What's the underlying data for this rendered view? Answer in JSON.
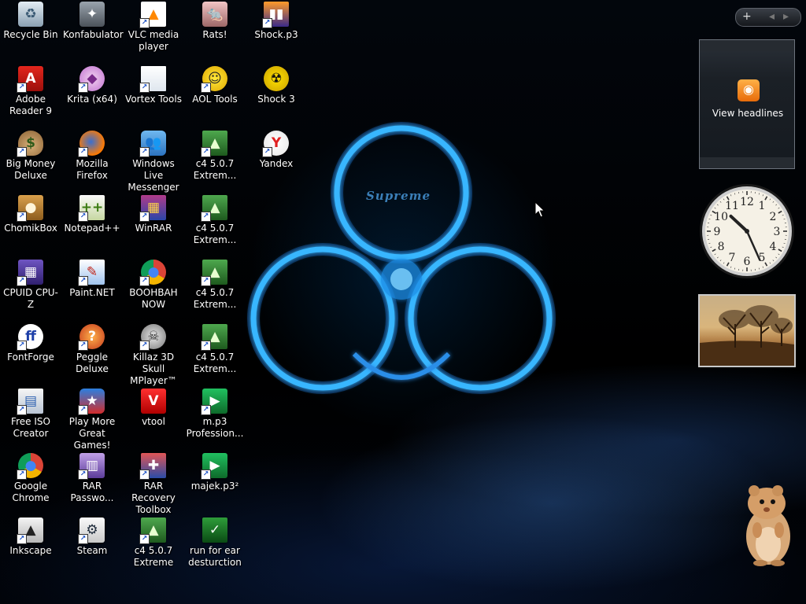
{
  "desktop": {
    "wallpaper_text": "Supreme",
    "icons": [
      {
        "label": "Recycle Bin",
        "icon": "recycle-bin-icon",
        "shortcut": false
      },
      {
        "label": "Adobe Reader 9",
        "icon": "adobe-reader-icon",
        "shortcut": true
      },
      {
        "label": "Big Money Deluxe",
        "icon": "money-bag-icon",
        "shortcut": true
      },
      {
        "label": "ChomikBox",
        "icon": "chomikbox-icon",
        "shortcut": true
      },
      {
        "label": "CPUID CPU-Z",
        "icon": "cpu-z-icon",
        "shortcut": true
      },
      {
        "label": "FontForge",
        "icon": "fontforge-icon",
        "shortcut": true
      },
      {
        "label": "Free ISO Creator",
        "icon": "iso-creator-icon",
        "shortcut": true
      },
      {
        "label": "Google Chrome",
        "icon": "chrome-icon",
        "shortcut": true
      },
      {
        "label": "Inkscape",
        "icon": "inkscape-icon",
        "shortcut": true
      },
      {
        "label": "Konfabulator",
        "icon": "konfabulator-icon",
        "shortcut": false
      },
      {
        "label": "Krita (x64)",
        "icon": "krita-icon",
        "shortcut": true
      },
      {
        "label": "Mozilla Firefox",
        "icon": "firefox-icon",
        "shortcut": true
      },
      {
        "label": "Notepad++",
        "icon": "notepad-plus-plus-icon",
        "shortcut": true
      },
      {
        "label": "Paint.NET",
        "icon": "paint-net-icon",
        "shortcut": true
      },
      {
        "label": "Peggle Deluxe",
        "icon": "peggle-icon",
        "shortcut": true
      },
      {
        "label": "Play More Great Games!",
        "icon": "games-icon",
        "shortcut": true
      },
      {
        "label": "RAR Passwo...",
        "icon": "rar-password-icon",
        "shortcut": true
      },
      {
        "label": "Steam",
        "icon": "steam-icon",
        "shortcut": true
      },
      {
        "label": "VLC media player",
        "icon": "vlc-icon",
        "shortcut": true
      },
      {
        "label": "Vortex Tools",
        "icon": "document-icon",
        "shortcut": true
      },
      {
        "label": "Windows Live Messenger",
        "icon": "messenger-icon",
        "shortcut": true
      },
      {
        "label": "WinRAR",
        "icon": "winrar-icon",
        "shortcut": true
      },
      {
        "label": "BOOHBAH NOW",
        "icon": "chrome-icon",
        "shortcut": true
      },
      {
        "label": "Killaz 3D Skull MPlayer™",
        "icon": "skull-icon",
        "shortcut": true
      },
      {
        "label": "vtool",
        "icon": "vtool-icon",
        "shortcut": false
      },
      {
        "label": "RAR Recovery Toolbox",
        "icon": "rar-recovery-icon",
        "shortcut": true
      },
      {
        "label": "c4 5.0.7 Extreme",
        "icon": "c4-icon",
        "shortcut": true
      },
      {
        "label": "Rats!",
        "icon": "rats-icon",
        "shortcut": false
      },
      {
        "label": "AOL Tools",
        "icon": "aol-icon",
        "shortcut": true
      },
      {
        "label": "c4 5.0.7 Extrem...",
        "icon": "c4-icon",
        "shortcut": true
      },
      {
        "label": "c4 5.0.7 Extrem...",
        "icon": "c4-icon",
        "shortcut": true
      },
      {
        "label": "c4 5.0.7 Extrem...",
        "icon": "c4-icon",
        "shortcut": true
      },
      {
        "label": "c4 5.0.7 Extrem...",
        "icon": "c4-icon",
        "shortcut": true
      },
      {
        "label": "m.p3 Profession...",
        "icon": "media-player-icon",
        "shortcut": true
      },
      {
        "label": "majek.p3²",
        "icon": "media-player-icon",
        "shortcut": true
      },
      {
        "label": "run for ear desturction",
        "icon": "green-app-icon",
        "shortcut": false
      },
      {
        "label": "Shock.p3",
        "icon": "shock-p3-icon",
        "shortcut": true
      },
      {
        "label": "Shock 3",
        "icon": "radiation-icon",
        "shortcut": false
      },
      {
        "label": "Yandex",
        "icon": "yandex-icon",
        "shortcut": true
      }
    ]
  },
  "gadgets": {
    "toolbar": {
      "add": "+",
      "prev": "◂",
      "next": "▸"
    },
    "feed": {
      "label": "View headlines",
      "icon": "rss-icon"
    },
    "clock": {
      "hour": 10,
      "minute": 26,
      "numerals": [
        "12",
        "1",
        "2",
        "3",
        "4",
        "5",
        "6",
        "7",
        "8",
        "9",
        "10",
        "11"
      ]
    },
    "slideshow": {
      "icon": "landscape-photo"
    },
    "mascot": {
      "icon": "hamster-icon"
    }
  },
  "colors": {
    "accent_glow": "#39b6ff",
    "text": "#ffffff"
  }
}
